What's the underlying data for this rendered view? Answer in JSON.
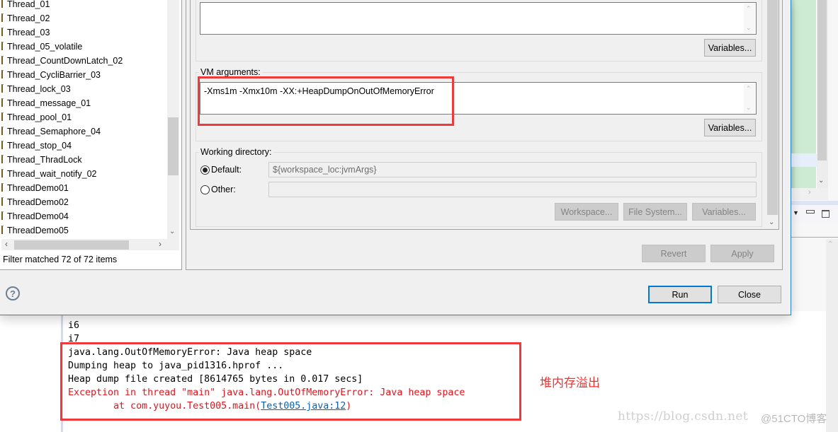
{
  "launch_tree": {
    "items": [
      "Thread_01",
      "Thread_02",
      "Thread_03",
      "Thread_05_volatile",
      "Thread_CountDownLatch_02",
      "Thread_CycliBarrier_03",
      "Thread_lock_03",
      "Thread_message_01",
      "Thread_pool_01",
      "Thread_Semaphore_04",
      "Thread_stop_04",
      "Thread_ThradLock",
      "Thread_wait_notify_02",
      "ThreadDemo01",
      "ThreadDemo02",
      "ThreadDemo04",
      "ThreadDemo05"
    ],
    "filter_status": "Filter matched 72 of 72 items"
  },
  "arguments_tab": {
    "program_arguments_value": "",
    "program_variables_label": "Variables...",
    "vm_arguments_label": "VM arguments:",
    "vm_arguments_value": "-Xms1m -Xmx10m -XX:+HeapDumpOnOutOfMemoryError",
    "vm_variables_label": "Variables...",
    "working_directory": {
      "label": "Working directory:",
      "default_label": "Default:",
      "default_value": "${workspace_loc:jvmArgs}",
      "other_label": "Other:",
      "other_value": "",
      "selected": "default",
      "workspace_label": "Workspace...",
      "file_system_label": "File System...",
      "variables_label": "Variables..."
    }
  },
  "dialog_buttons": {
    "revert": "Revert",
    "apply": "Apply",
    "run": "Run",
    "close": "Close",
    "help": "?"
  },
  "console": {
    "lines": [
      {
        "text": "i6",
        "type": "normal"
      },
      {
        "text": "i7",
        "type": "normal"
      },
      {
        "text": "java.lang.OutOfMemoryError: Java heap space",
        "type": "normal"
      },
      {
        "text": "Dumping heap to java_pid1316.hprof ...",
        "type": "normal"
      },
      {
        "text": "Heap dump file created [8614765 bytes in 0.017 secs]",
        "type": "normal"
      },
      {
        "text": "Exception in thread \"main\" java.lang.OutOfMemoryError: Java heap space",
        "type": "error"
      }
    ],
    "stack_prefix": "\tat com.yuyou.Test005.main(",
    "stack_link": "Test005.java:12",
    "stack_suffix": ")"
  },
  "annotation": {
    "text": "堆内存溢出",
    "color": "#ee3a3a"
  },
  "watermark": {
    "url": "https://blog.csdn.net",
    "site": "@51CTO博客"
  }
}
